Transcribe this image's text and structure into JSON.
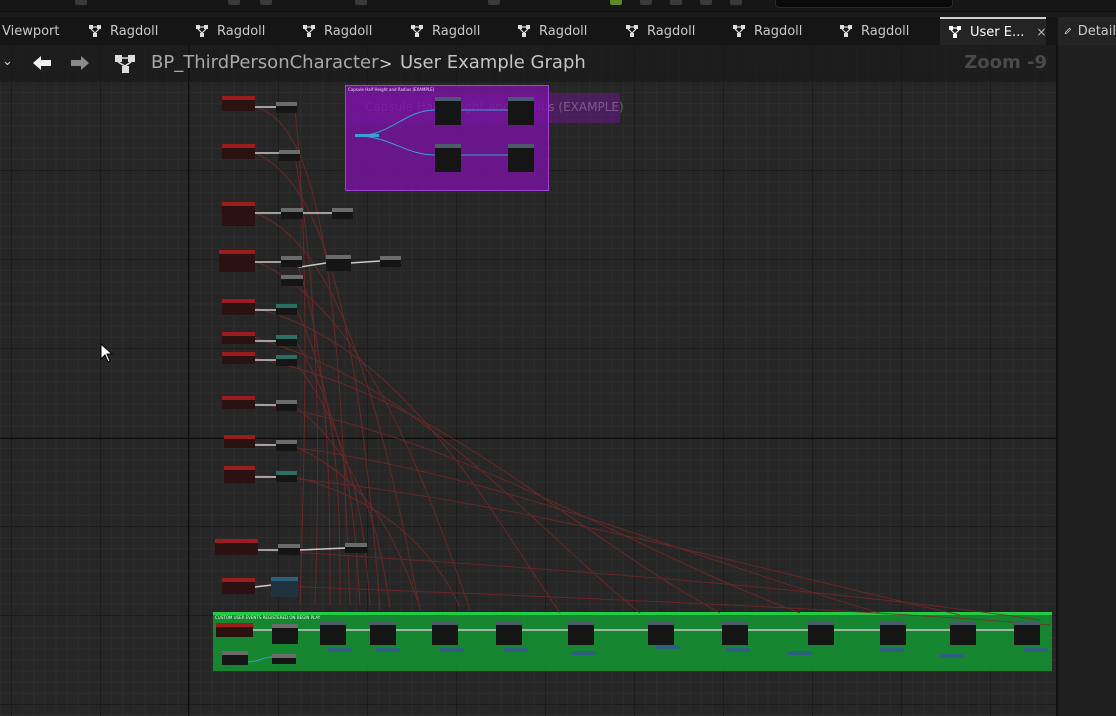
{
  "tabs": [
    {
      "label": "Viewport",
      "active": false,
      "icon": "viewport"
    },
    {
      "label": "Ragdoll",
      "active": false,
      "icon": "graph-icon"
    },
    {
      "label": "Ragdoll",
      "active": false,
      "icon": "graph-icon"
    },
    {
      "label": "Ragdoll",
      "active": false,
      "icon": "graph-icon"
    },
    {
      "label": "Ragdoll",
      "active": false,
      "icon": "graph-icon"
    },
    {
      "label": "Ragdoll",
      "active": false,
      "icon": "graph-icon"
    },
    {
      "label": "Ragdoll",
      "active": false,
      "icon": "graph-icon"
    },
    {
      "label": "Ragdoll",
      "active": false,
      "icon": "graph-icon"
    },
    {
      "label": "Ragdoll",
      "active": false,
      "icon": "graph-icon"
    },
    {
      "label": "User E...",
      "active": true,
      "icon": "graph-icon",
      "close": "×"
    }
  ],
  "details_tab": {
    "label": "Detail"
  },
  "breadcrumb": {
    "dropdown_glyph": "⌄",
    "root": "BP_ThirdPersonCharacter",
    "separator": ">",
    "current": "User Example Graph",
    "zoom": "Zoom -9"
  },
  "comments": {
    "purple_title": "Capsule Half Height and Radius (EXAMPLE)",
    "purple_ghost": "Capsule Half Height and Radius (EXAMPLE)",
    "green_title": "CUSTOM USER EVENTS REGISTERED ON BEGIN PLAY"
  },
  "colors": {
    "graph_bg": "#262626",
    "exec_node_red": "#9a1c1c",
    "comment_purple": "#7814a0",
    "comment_green": "#149632",
    "wire_red": "#8a2a2a",
    "wire_blue": "#3aa0d0",
    "wire_white": "#c8c8c8",
    "active_tab_border": "#d0d0d0"
  }
}
